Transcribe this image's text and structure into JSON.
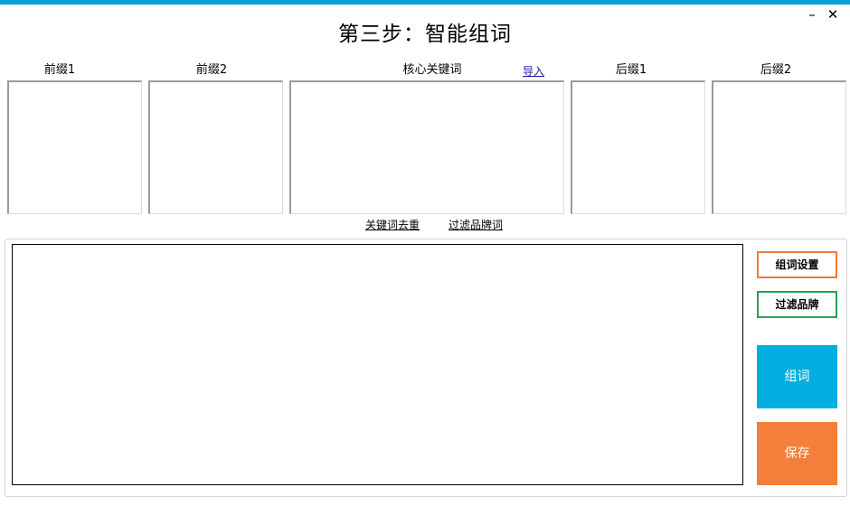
{
  "window": {
    "title": "第三步：智能组词",
    "minimize_glyph": "–",
    "close_glyph": "✕",
    "accent_color": "#00a0d6"
  },
  "columns": [
    {
      "label": "前缀1"
    },
    {
      "label": "前缀2"
    },
    {
      "label": "核心关键词"
    },
    {
      "label": "后缀1"
    },
    {
      "label": "后缀2"
    }
  ],
  "import_link": "导入",
  "tools": {
    "dedupe_link": "关键词去重",
    "filter_brand_link": "过滤品牌词"
  },
  "buttons": {
    "setting": "组词设置",
    "filter_brand": "过滤品牌",
    "combine": "组词",
    "save": "保存"
  },
  "colors": {
    "setting_border": "#ef7a3c",
    "filter_border": "#2aa05a",
    "combine_bg": "#02aee0",
    "save_bg": "#f37f3a"
  }
}
